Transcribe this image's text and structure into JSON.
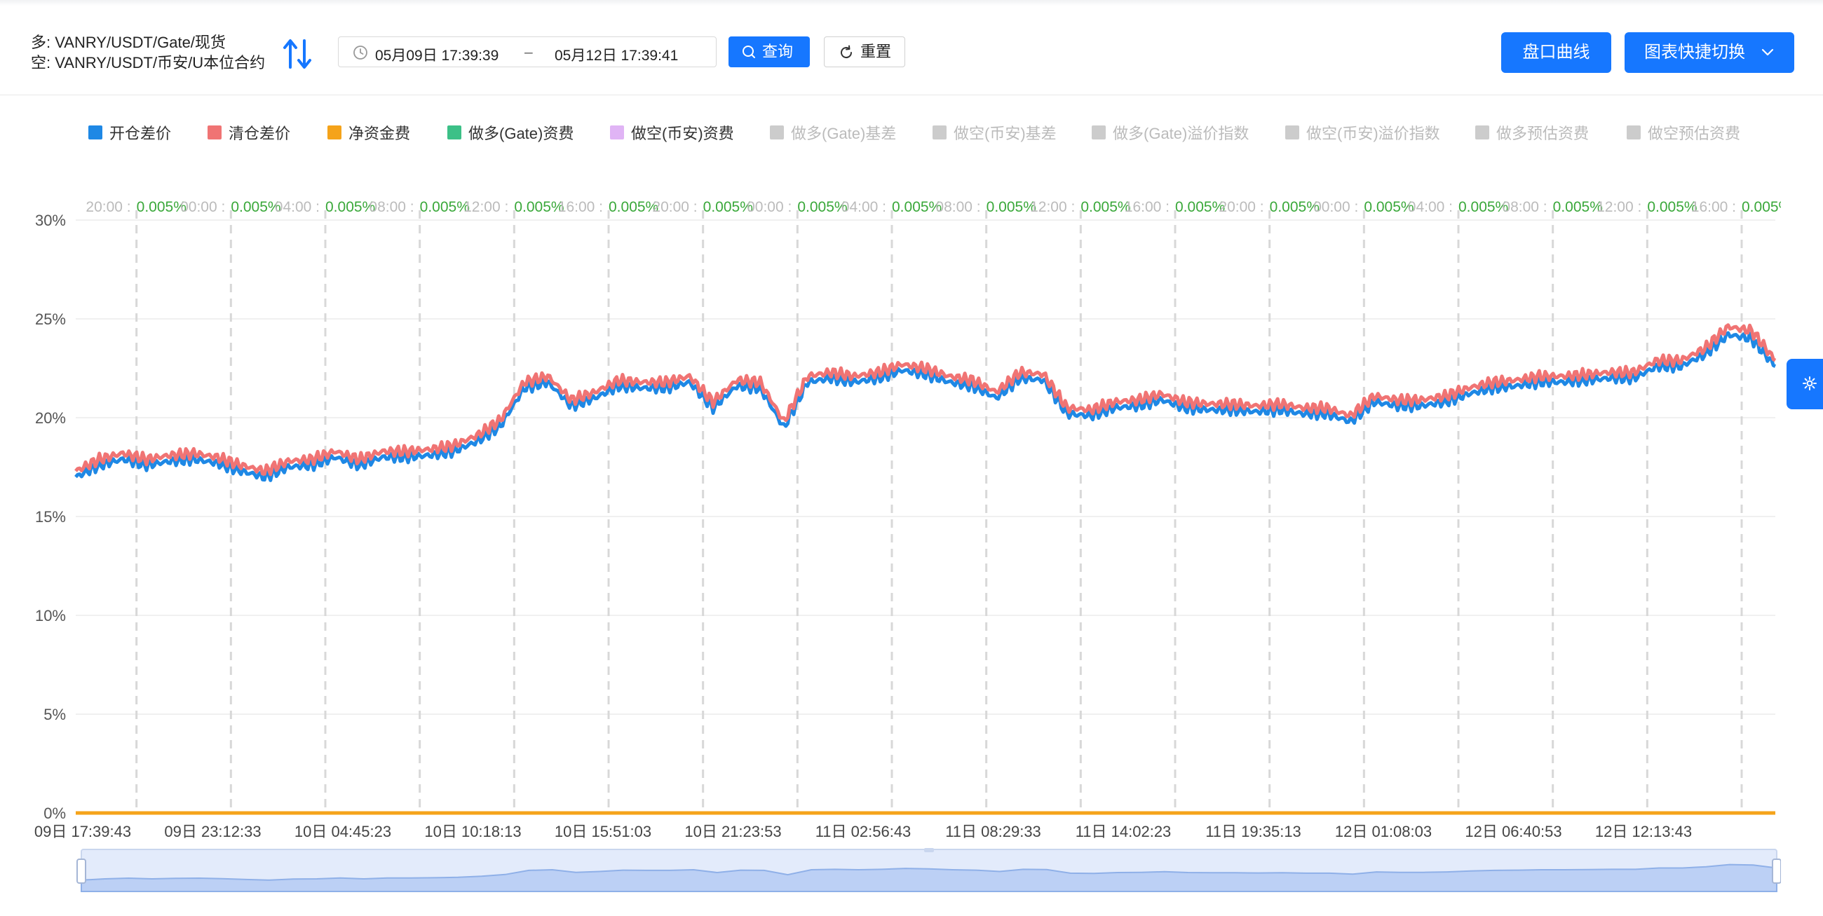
{
  "header": {
    "long_pair": "多: VANRY/USDT/Gate/现货",
    "short_pair": "空: VANRY/USDT/币安/U本位合约",
    "swap_icon": "swap-arrows-icon",
    "range_start": "05月09日 17:39:39",
    "range_separator": "–",
    "range_end": "05月12日 17:39:41",
    "query_label": "查询",
    "reset_label": "重置",
    "curve_label": "盘口曲线",
    "switch_label": "图表快捷切换"
  },
  "legend": [
    {
      "label": "开仓差价",
      "color": "#1e88e5",
      "active": true
    },
    {
      "label": "清仓差价",
      "color": "#f07474",
      "active": true
    },
    {
      "label": "净资金费",
      "color": "#f5a31a",
      "active": true
    },
    {
      "label": "做多(Gate)资费",
      "color": "#3cc087",
      "active": true
    },
    {
      "label": "做空(币安)资费",
      "color": "#e0b4f5",
      "active": true
    },
    {
      "label": "做多(Gate)基差",
      "color": "#cccccc",
      "active": false
    },
    {
      "label": "做空(币安)基差",
      "color": "#cccccc",
      "active": false
    },
    {
      "label": "做多(Gate)溢价指数",
      "color": "#cccccc",
      "active": false
    },
    {
      "label": "做空(币安)溢价指数",
      "color": "#cccccc",
      "active": false
    },
    {
      "label": "做多预估资费",
      "color": "#cccccc",
      "active": false
    },
    {
      "label": "做空预估资费",
      "color": "#cccccc",
      "active": false
    }
  ],
  "funding_markers": {
    "times": [
      "20:00",
      "00:00",
      "04:00",
      "08:00",
      "12:00",
      "16:00",
      "20:00",
      "00:00",
      "04:00",
      "08:00",
      "12:00",
      "16:00",
      "20:00",
      "00:00",
      "04:00",
      "08:00",
      "12:00",
      "16:00"
    ],
    "rate": "0.005%"
  },
  "chart_data": {
    "type": "line",
    "ylim": [
      0,
      30
    ],
    "yticks": [
      "0%",
      "5%",
      "10%",
      "15%",
      "20%",
      "25%",
      "30%"
    ],
    "grid": true,
    "legend_position": "top",
    "x_tick_labels": [
      "09日 17:39:43",
      "09日 23:12:33",
      "10日 04:45:23",
      "10日 10:18:13",
      "10日 15:51:03",
      "10日 21:23:53",
      "11日 02:56:43",
      "11日 08:29:33",
      "11日 14:02:23",
      "11日 19:35:13",
      "12日 01:08:03",
      "12日 06:40:53",
      "12日 12:13:43"
    ],
    "x_hours": [
      0,
      10,
      20,
      30,
      40,
      50,
      60,
      70,
      80,
      90,
      100,
      110,
      120,
      130,
      140,
      150,
      160,
      170,
      180,
      190,
      200,
      210,
      220,
      230,
      240,
      250,
      260,
      270,
      280,
      290,
      300,
      310,
      320,
      330,
      340,
      350,
      360,
      370,
      380,
      390,
      400,
      410,
      420,
      430,
      440,
      450,
      460,
      470,
      480,
      490,
      500,
      510,
      520,
      530,
      540,
      550,
      560,
      570,
      580,
      590,
      600,
      610,
      620,
      630,
      640,
      650,
      660,
      670,
      680,
      690,
      700,
      710,
      720
    ],
    "x_note_unit": "tenths of an hour since 09日 17:39:43",
    "series": [
      {
        "name": "开仓差价",
        "color": "#1e88e5",
        "values": [
          17.0,
          17.6,
          17.9,
          17.6,
          17.8,
          17.9,
          17.7,
          17.3,
          17.0,
          17.5,
          17.6,
          18.0,
          17.6,
          18.0,
          18.0,
          18.1,
          18.3,
          18.8,
          19.6,
          21.5,
          21.8,
          20.6,
          21.0,
          21.6,
          21.5,
          21.5,
          21.8,
          20.5,
          21.6,
          21.5,
          19.5,
          21.8,
          22.0,
          21.8,
          22.0,
          22.4,
          22.2,
          21.8,
          21.6,
          21.0,
          22.0,
          21.9,
          20.2,
          20.1,
          20.5,
          20.6,
          20.9,
          20.5,
          20.4,
          20.4,
          20.3,
          20.4,
          20.2,
          20.2,
          19.8,
          20.8,
          20.6,
          20.6,
          20.8,
          21.2,
          21.5,
          21.6,
          21.8,
          21.8,
          21.9,
          22.0,
          22.0,
          22.6,
          22.6,
          23.2,
          24.2,
          24.0,
          22.6
        ]
      },
      {
        "name": "清仓差价",
        "color": "#f07474",
        "values": [
          17.3,
          17.9,
          18.2,
          17.9,
          18.1,
          18.2,
          18.0,
          17.6,
          17.3,
          17.8,
          17.9,
          18.3,
          17.9,
          18.3,
          18.3,
          18.4,
          18.6,
          19.1,
          19.9,
          21.8,
          22.1,
          20.9,
          21.3,
          21.9,
          21.8,
          21.8,
          22.1,
          20.8,
          21.9,
          21.8,
          19.8,
          22.1,
          22.3,
          22.1,
          22.3,
          22.7,
          22.5,
          22.1,
          21.9,
          21.3,
          22.3,
          22.2,
          20.5,
          20.4,
          20.8,
          20.9,
          21.2,
          20.8,
          20.7,
          20.7,
          20.6,
          20.7,
          20.5,
          20.5,
          20.1,
          21.1,
          20.9,
          20.9,
          21.1,
          21.5,
          21.8,
          21.9,
          22.1,
          22.1,
          22.2,
          22.3,
          22.3,
          22.9,
          22.9,
          23.5,
          24.6,
          24.4,
          22.9
        ]
      },
      {
        "name": "净资金费",
        "color": "#f5a31a",
        "values": [
          0,
          0
        ]
      }
    ]
  }
}
